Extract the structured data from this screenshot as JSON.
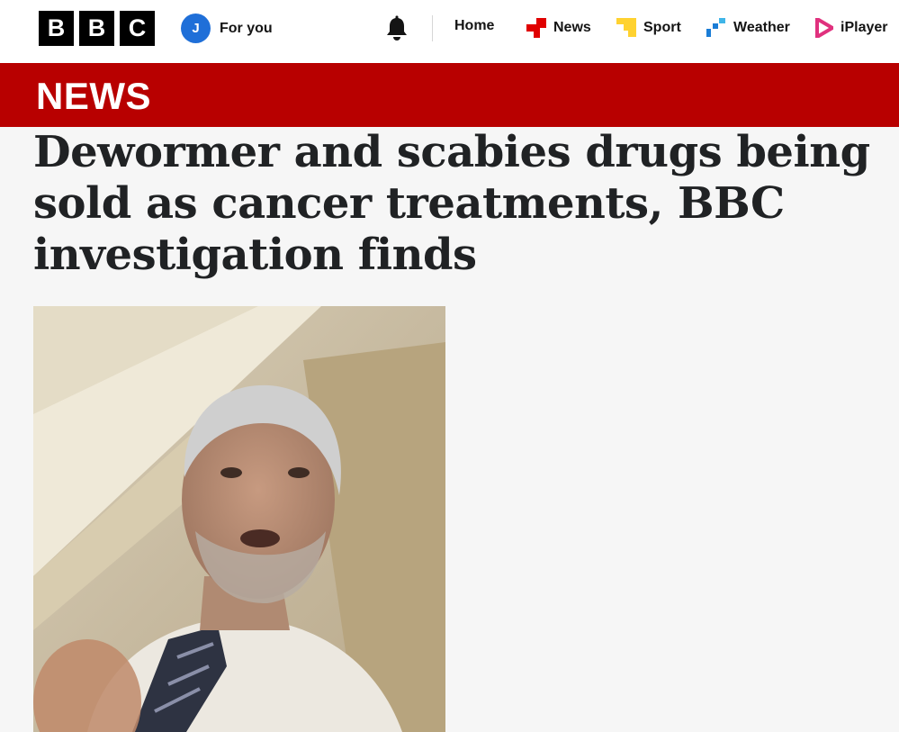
{
  "header": {
    "logo_letters": [
      "B",
      "B",
      "C"
    ],
    "avatar_initial": "J",
    "for_you_label": "For you",
    "bell_icon": "bell-icon",
    "nav": {
      "home": "Home",
      "news": "News",
      "sport": "Sport",
      "weather": "Weather",
      "iplayer": "iPlayer"
    }
  },
  "banner": {
    "label": "NEWS",
    "color": "#b80000"
  },
  "article": {
    "headline": "Dewormer and scabies drugs being sold as cancer treatments, BBC investigation finds"
  },
  "colors": {
    "avatar": "#1f6fd8",
    "news_icon": "#e00000",
    "sport_icon": "#ffd230",
    "weather_icon": "#1b7dd6",
    "iplayer_icon": "#e0317e"
  }
}
